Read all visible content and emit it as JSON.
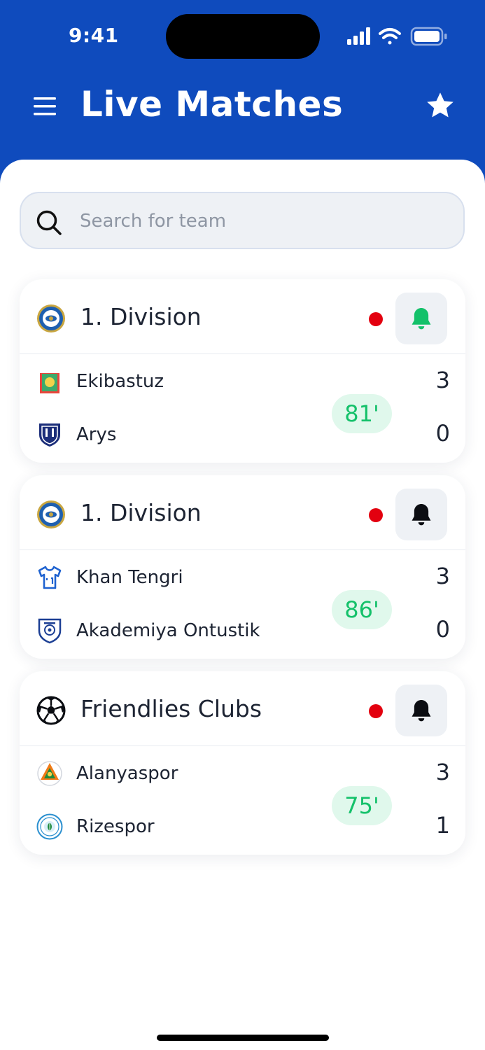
{
  "status_bar": {
    "time": "9:41"
  },
  "header": {
    "title": "Live Matches",
    "menu_icon": "hamburger-menu-icon",
    "favorites_icon": "star-icon"
  },
  "search": {
    "placeholder": "Search for team",
    "value": "",
    "icon": "search-icon"
  },
  "colors": {
    "brand": "#0F4BBD",
    "live": "#E3000F",
    "minute_text": "#14C16A",
    "minute_bg": "#E0F8EC",
    "bell_active": "#14C16A"
  },
  "matches": [
    {
      "league": "1. Division",
      "league_icon": "kazakhstan-league-badge-icon",
      "notifications_on": true,
      "minute": "81'",
      "home": {
        "name": "Ekibastuz",
        "score": "3",
        "icon": "ekibastuz-crest-icon"
      },
      "away": {
        "name": "Arys",
        "score": "0",
        "icon": "arys-shield-icon"
      }
    },
    {
      "league": "1. Division",
      "league_icon": "kazakhstan-league-badge-icon",
      "notifications_on": false,
      "minute": "86'",
      "home": {
        "name": "Khan Tengri",
        "score": "3",
        "icon": "jersey-icon"
      },
      "away": {
        "name": "Akademiya Ontustik",
        "score": "0",
        "icon": "akademiya-shield-icon"
      }
    },
    {
      "league": "Friendlies Clubs",
      "league_icon": "soccer-ball-icon",
      "notifications_on": false,
      "minute": "75'",
      "home": {
        "name": "Alanyaspor",
        "score": "3",
        "icon": "alanyaspor-crest-icon"
      },
      "away": {
        "name": "Rizespor",
        "score": "1",
        "icon": "rizespor-crest-icon"
      }
    }
  ]
}
